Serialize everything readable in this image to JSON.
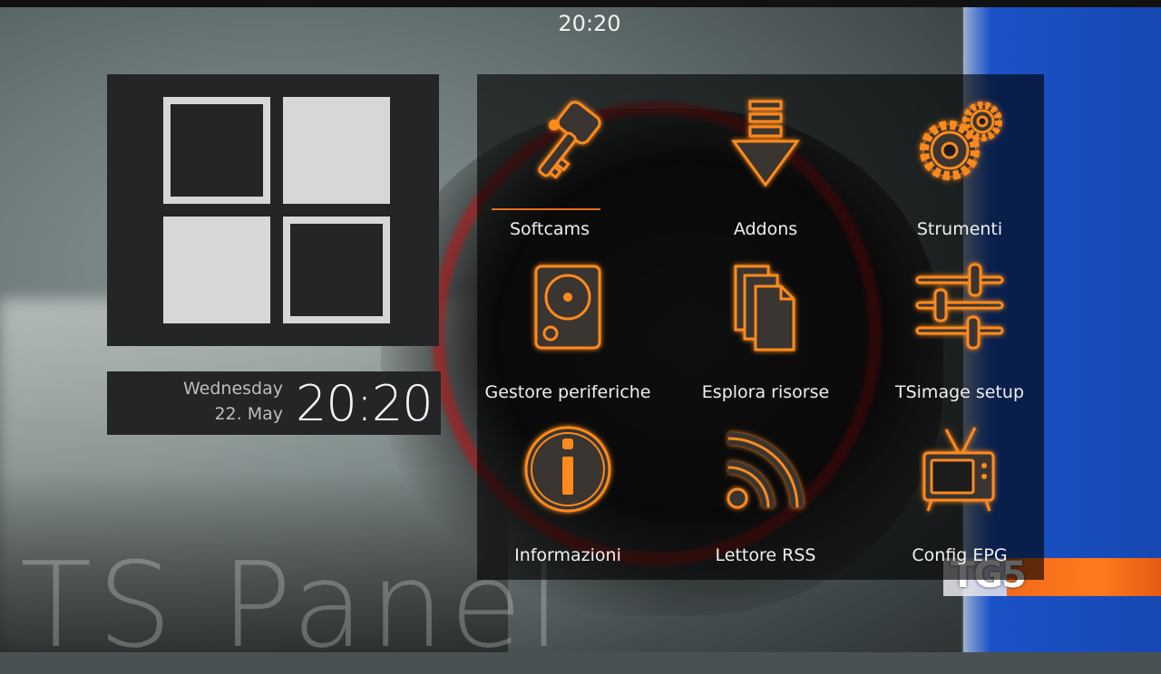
{
  "status_bar": {
    "clock": "20:20"
  },
  "datetime": {
    "day": "Wednesday",
    "date": "22. May",
    "time": "20:20"
  },
  "menu": {
    "items": [
      {
        "label": "Softcams",
        "icon": "key-icon",
        "focused": true
      },
      {
        "label": "Addons",
        "icon": "download-arrow-icon"
      },
      {
        "label": "Strumenti",
        "icon": "gears-icon"
      },
      {
        "label": "Gestore periferiche",
        "icon": "hard-disk-icon"
      },
      {
        "label": "Esplora risorse",
        "icon": "files-icon"
      },
      {
        "label": "TSimage setup",
        "icon": "sliders-icon"
      },
      {
        "label": "Informazioni",
        "icon": "info-icon"
      },
      {
        "label": "Lettore RSS",
        "icon": "rss-icon"
      },
      {
        "label": "Config EPG",
        "icon": "tv-icon"
      }
    ]
  },
  "watermark": "TS Panel",
  "channel_logo": "TG5",
  "colors": {
    "accent_orange": "#e6701e",
    "icon_glow": "#ff8a1a",
    "panel_dark": "#242526",
    "tile_light": "#d6d7d6"
  }
}
